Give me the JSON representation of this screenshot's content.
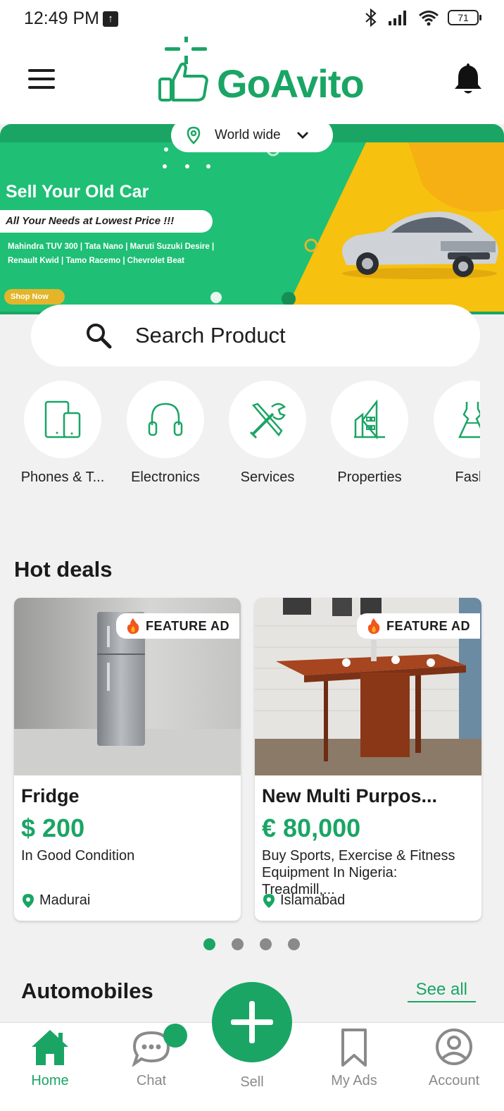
{
  "status_bar": {
    "time": "12:49 PM",
    "battery": "71"
  },
  "header": {
    "brand": "GoAvito"
  },
  "location": {
    "label": "World wide"
  },
  "banner": {
    "title": "Sell Your Old Car",
    "tagline": "All Your Needs at Lowest Price !!!",
    "models_line1": "Mahindra TUV 300 | Tata Nano | Maruti Suzuki Desire |",
    "models_line2": "Renault Kwid | Tamo Racemo | Chevrolet Beat",
    "cta": "Shop Now"
  },
  "search": {
    "placeholder": "Search Product"
  },
  "categories": [
    {
      "label": "Phones & T...",
      "icon": "phone-tablet-icon"
    },
    {
      "label": "Electronics",
      "icon": "headphones-icon"
    },
    {
      "label": "Services",
      "icon": "tools-icon"
    },
    {
      "label": "Properties",
      "icon": "building-icon"
    },
    {
      "label": "Fashi",
      "icon": "dress-icon"
    }
  ],
  "hot_deals": {
    "title": "Hot deals",
    "badge": "FEATURE AD",
    "items": [
      {
        "name": "Fridge",
        "price": "$ 200",
        "description": "In Good Condition",
        "location": "Madurai"
      },
      {
        "name": "New Multi Purpos...",
        "price": "€ 80,000",
        "description": "Buy Sports, Exercise & Fitness Equipment In Nigeria: Treadmill,...",
        "location": "Islamabad"
      }
    ],
    "carousel": {
      "pages": 4,
      "active": 1
    }
  },
  "automobiles": {
    "title": "Automobiles",
    "see_all": "See all"
  },
  "bottom_nav": {
    "home": "Home",
    "chat": "Chat",
    "sell": "Sell",
    "my_ads": "My Ads",
    "account": "Account"
  },
  "colors": {
    "brand": "#1aa565",
    "banner_yellow": "#f6c10f",
    "inactive": "#8a8a8a"
  }
}
